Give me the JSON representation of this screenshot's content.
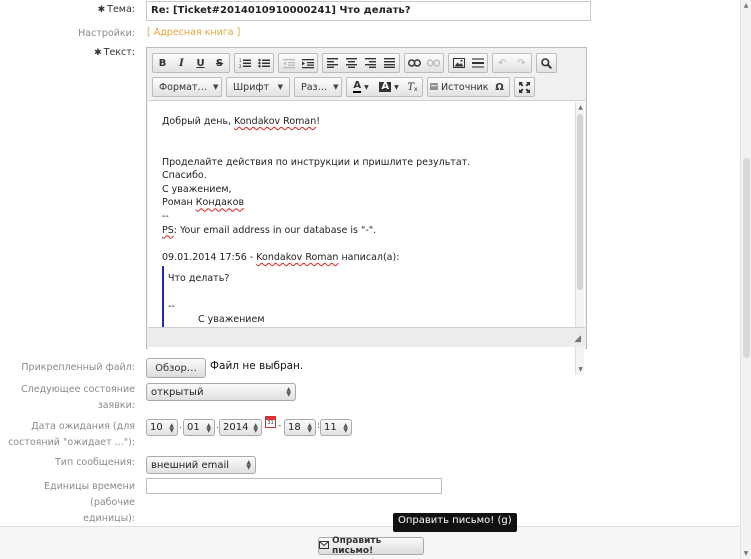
{
  "form": {
    "subject_label": "Тема:",
    "subject_value": "Re: [Ticket#2014010910000241] Что делать?",
    "settings_label": "Настройки:",
    "address_book_link": "[ Адресная книга ]",
    "text_label": "Текст:",
    "attachment_label": "Прикрепленный файл:",
    "browse_button": "Обзор…",
    "no_file_text": "Файл не выбран.",
    "next_state_label_1": "Следующее состояние",
    "next_state_label_2": "заявки:",
    "next_state_value": "открытый",
    "pending_date_label_1": "Дата ожидания (для",
    "pending_date_label_2": "состояний \"ожидает ...\"):",
    "date": {
      "day": "10",
      "month": "01",
      "year": "2014",
      "hour": "18",
      "minute": "11",
      "dot": ".",
      "dash": "-",
      "colon": ":"
    },
    "message_type_label": "Тип сообщения:",
    "message_type_value": "внешний email",
    "time_units_label_1": "Единицы времени (рабочие",
    "time_units_label_2": "единицы):",
    "time_units_value": ""
  },
  "toolbar": {
    "format_combo": "Формат…",
    "font_combo": "Шрифт",
    "size_combo": "Раз…",
    "source_button": "Источник"
  },
  "editor": {
    "greeting_prefix": "Добрый день, ",
    "greeting_name": "Kondakov Roman",
    "greeting_suffix": "!",
    "line_instructions": "Проделайте действия по инструкции и пришлите результат.",
    "line_thanks": "Спасибо.",
    "line_regards": "С уважением,",
    "line_sig_first": "Роман ",
    "line_sig_last": "Кондаков",
    "line_dash": "--",
    "line_ps_prefix": "PS",
    "line_ps_body": ": Your email address in our database is \"-\".",
    "quote_header_prefix": "09.01.2014 17:56 - ",
    "quote_header_name": "Kondakov Roman",
    "quote_header_suffix": " написал(а):",
    "quote_question": "Что делать?",
    "quote_dash": "--",
    "quote_regards": "С уважением"
  },
  "footer": {
    "send_button": "Оправить письмо!",
    "tooltip": "Оправить письмо! (g)"
  }
}
